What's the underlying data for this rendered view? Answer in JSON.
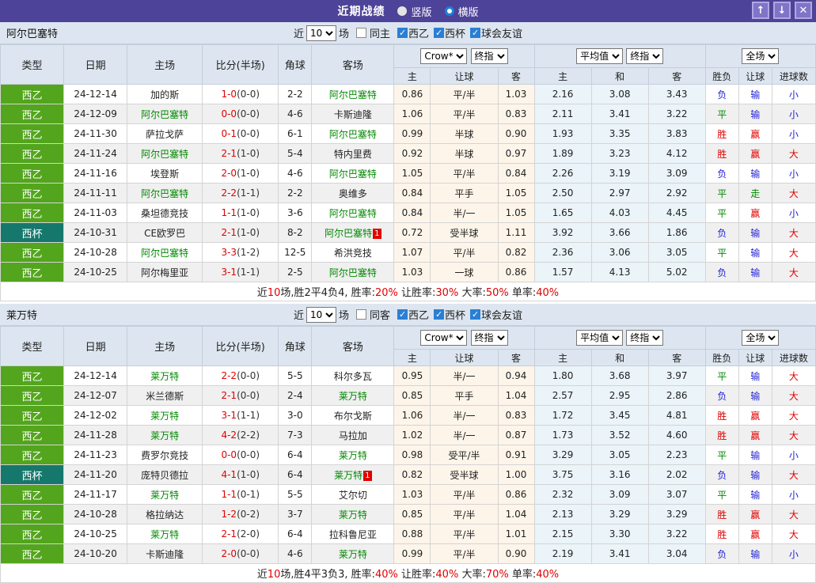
{
  "titlebar": {
    "title": "近期战绩",
    "radios": [
      {
        "label": "竖版",
        "selected": false
      },
      {
        "label": "横版",
        "selected": true
      }
    ],
    "buttons": {
      "up": "↑",
      "down": "↓",
      "close": "✕"
    }
  },
  "colors": {
    "titlebar_purple": "#4d4398",
    "league_green": "#53a51d",
    "cup_teal": "#16786d",
    "team_highlight_green": "#008800",
    "score_red": "#e00000",
    "result_blue": "#2323d3",
    "odds_col_bg": "#fdf5ea",
    "avg_col_bg": "#eaf4f9",
    "header_bg": "#dde6f0"
  },
  "header": {
    "col_type": "类型",
    "col_date": "日期",
    "col_home": "主场",
    "col_score": "比分(半场)",
    "col_corner": "角球",
    "col_away": "客场",
    "dd_crow": "Crow*",
    "dd_final1": "终指",
    "dd_avg": "平均值",
    "dd_final2": "终指",
    "dd_full": "全场",
    "sub": [
      "主",
      "让球",
      "客",
      "主",
      "和",
      "客",
      "胜负",
      "让球",
      "进球数"
    ]
  },
  "sections": [
    {
      "team": "阿尔巴塞特",
      "filter": {
        "prefix": "近",
        "count": "10",
        "suffix": "场",
        "same": {
          "label": "同主",
          "checked": false
        },
        "leagues": [
          {
            "label": "西乙",
            "checked": true
          },
          {
            "label": "西杯",
            "checked": true
          },
          {
            "label": "球会友谊",
            "checked": true
          }
        ]
      },
      "rows": [
        {
          "type": "西乙",
          "cup": false,
          "date": "24-12-14",
          "home": "加的斯",
          "home_hl": false,
          "home_badge": "",
          "score": "1-0",
          "half": "(0-0)",
          "corner": "2-2",
          "away": "阿尔巴塞特",
          "away_hl": true,
          "away_badge": "",
          "o1": "0.86",
          "o2": "平/半",
          "o3": "1.03",
          "a1": "2.16",
          "a2": "3.08",
          "a3": "3.43",
          "r1": "负",
          "r1c": "b",
          "r2": "输",
          "r2c": "b",
          "r3": "小",
          "r3c": "b"
        },
        {
          "type": "西乙",
          "cup": false,
          "date": "24-12-09",
          "home": "阿尔巴塞特",
          "home_hl": true,
          "home_badge": "",
          "score": "0-0",
          "half": "(0-0)",
          "corner": "4-6",
          "away": "卡斯迪隆",
          "away_hl": false,
          "away_badge": "",
          "o1": "1.06",
          "o2": "平/半",
          "o3": "0.83",
          "a1": "2.11",
          "a2": "3.41",
          "a3": "3.22",
          "r1": "平",
          "r1c": "g",
          "r2": "输",
          "r2c": "b",
          "r3": "小",
          "r3c": "b"
        },
        {
          "type": "西乙",
          "cup": false,
          "date": "24-11-30",
          "home": "萨拉戈萨",
          "home_hl": false,
          "home_badge": "",
          "score": "0-1",
          "half": "(0-0)",
          "corner": "6-1",
          "away": "阿尔巴塞特",
          "away_hl": true,
          "away_badge": "",
          "o1": "0.99",
          "o2": "半球",
          "o3": "0.90",
          "a1": "1.93",
          "a2": "3.35",
          "a3": "3.83",
          "r1": "胜",
          "r1c": "r",
          "r2": "赢",
          "r2c": "r",
          "r3": "小",
          "r3c": "b"
        },
        {
          "type": "西乙",
          "cup": false,
          "date": "24-11-24",
          "home": "阿尔巴塞特",
          "home_hl": true,
          "home_badge": "",
          "score": "2-1",
          "half": "(1-0)",
          "corner": "5-4",
          "away": "特内里费",
          "away_hl": false,
          "away_badge": "",
          "o1": "0.92",
          "o2": "半球",
          "o3": "0.97",
          "a1": "1.89",
          "a2": "3.23",
          "a3": "4.12",
          "r1": "胜",
          "r1c": "r",
          "r2": "赢",
          "r2c": "r",
          "r3": "大",
          "r3c": "r"
        },
        {
          "type": "西乙",
          "cup": false,
          "date": "24-11-16",
          "home": "埃登斯",
          "home_hl": false,
          "home_badge": "",
          "score": "2-0",
          "half": "(1-0)",
          "corner": "4-6",
          "away": "阿尔巴塞特",
          "away_hl": true,
          "away_badge": "",
          "o1": "1.05",
          "o2": "平/半",
          "o3": "0.84",
          "a1": "2.26",
          "a2": "3.19",
          "a3": "3.09",
          "r1": "负",
          "r1c": "b",
          "r2": "输",
          "r2c": "b",
          "r3": "小",
          "r3c": "b"
        },
        {
          "type": "西乙",
          "cup": false,
          "date": "24-11-11",
          "home": "阿尔巴塞特",
          "home_hl": true,
          "home_badge": "",
          "score": "2-2",
          "half": "(1-1)",
          "corner": "2-2",
          "away": "奥维多",
          "away_hl": false,
          "away_badge": "",
          "o1": "0.84",
          "o2": "平手",
          "o3": "1.05",
          "a1": "2.50",
          "a2": "2.97",
          "a3": "2.92",
          "r1": "平",
          "r1c": "g",
          "r2": "走",
          "r2c": "g",
          "r3": "大",
          "r3c": "r"
        },
        {
          "type": "西乙",
          "cup": false,
          "date": "24-11-03",
          "home": "桑坦德竞技",
          "home_hl": false,
          "home_badge": "",
          "score": "1-1",
          "half": "(1-0)",
          "corner": "3-6",
          "away": "阿尔巴塞特",
          "away_hl": true,
          "away_badge": "",
          "o1": "0.84",
          "o2": "半/一",
          "o3": "1.05",
          "a1": "1.65",
          "a2": "4.03",
          "a3": "4.45",
          "r1": "平",
          "r1c": "g",
          "r2": "赢",
          "r2c": "r",
          "r3": "小",
          "r3c": "b"
        },
        {
          "type": "西杯",
          "cup": true,
          "date": "24-10-31",
          "home": "CE欧罗巴",
          "home_hl": false,
          "home_badge": "",
          "score": "2-1",
          "half": "(1-0)",
          "corner": "8-2",
          "away": "阿尔巴塞特",
          "away_hl": true,
          "away_badge": "1",
          "o1": "0.72",
          "o2": "受半球",
          "o3": "1.11",
          "a1": "3.92",
          "a2": "3.66",
          "a3": "1.86",
          "r1": "负",
          "r1c": "b",
          "r2": "输",
          "r2c": "b",
          "r3": "大",
          "r3c": "r"
        },
        {
          "type": "西乙",
          "cup": false,
          "date": "24-10-28",
          "home": "阿尔巴塞特",
          "home_hl": true,
          "home_badge": "",
          "score": "3-3",
          "half": "(1-2)",
          "corner": "12-5",
          "away": "希洪竞技",
          "away_hl": false,
          "away_badge": "",
          "o1": "1.07",
          "o2": "平/半",
          "o3": "0.82",
          "a1": "2.36",
          "a2": "3.06",
          "a3": "3.05",
          "r1": "平",
          "r1c": "g",
          "r2": "输",
          "r2c": "b",
          "r3": "大",
          "r3c": "r"
        },
        {
          "type": "西乙",
          "cup": false,
          "date": "24-10-25",
          "home": "阿尔梅里亚",
          "home_hl": false,
          "home_badge": "",
          "score": "3-1",
          "half": "(1-1)",
          "corner": "2-5",
          "away": "阿尔巴塞特",
          "away_hl": true,
          "away_badge": "",
          "o1": "1.03",
          "o2": "一球",
          "o3": "0.86",
          "a1": "1.57",
          "a2": "4.13",
          "a3": "5.02",
          "r1": "负",
          "r1c": "b",
          "r2": "输",
          "r2c": "b",
          "r3": "大",
          "r3c": "r"
        }
      ],
      "summary": [
        {
          "t": "近"
        },
        {
          "t": "10",
          "red": true
        },
        {
          "t": "场,胜2平4负4, 胜率:"
        },
        {
          "t": "20%",
          "red": true
        },
        {
          "t": " 让胜率:"
        },
        {
          "t": "30%",
          "red": true
        },
        {
          "t": " 大率:"
        },
        {
          "t": "50%",
          "red": true
        },
        {
          "t": " 单率:"
        },
        {
          "t": "40%",
          "red": true
        }
      ]
    },
    {
      "team": "莱万特",
      "filter": {
        "prefix": "近",
        "count": "10",
        "suffix": "场",
        "same": {
          "label": "同客",
          "checked": false
        },
        "leagues": [
          {
            "label": "西乙",
            "checked": true
          },
          {
            "label": "西杯",
            "checked": true
          },
          {
            "label": "球会友谊",
            "checked": true
          }
        ]
      },
      "rows": [
        {
          "type": "西乙",
          "cup": false,
          "date": "24-12-14",
          "home": "莱万特",
          "home_hl": true,
          "home_badge": "",
          "score": "2-2",
          "half": "(0-0)",
          "corner": "5-5",
          "away": "科尔多瓦",
          "away_hl": false,
          "away_badge": "",
          "o1": "0.95",
          "o2": "半/一",
          "o3": "0.94",
          "a1": "1.80",
          "a2": "3.68",
          "a3": "3.97",
          "r1": "平",
          "r1c": "g",
          "r2": "输",
          "r2c": "b",
          "r3": "大",
          "r3c": "r"
        },
        {
          "type": "西乙",
          "cup": false,
          "date": "24-12-07",
          "home": "米兰德斯",
          "home_hl": false,
          "home_badge": "",
          "score": "2-1",
          "half": "(0-0)",
          "corner": "2-4",
          "away": "莱万特",
          "away_hl": true,
          "away_badge": "",
          "o1": "0.85",
          "o2": "平手",
          "o3": "1.04",
          "a1": "2.57",
          "a2": "2.95",
          "a3": "2.86",
          "r1": "负",
          "r1c": "b",
          "r2": "输",
          "r2c": "b",
          "r3": "大",
          "r3c": "r"
        },
        {
          "type": "西乙",
          "cup": false,
          "date": "24-12-02",
          "home": "莱万特",
          "home_hl": true,
          "home_badge": "",
          "score": "3-1",
          "half": "(1-1)",
          "corner": "3-0",
          "away": "布尔戈斯",
          "away_hl": false,
          "away_badge": "",
          "o1": "1.06",
          "o2": "半/一",
          "o3": "0.83",
          "a1": "1.72",
          "a2": "3.45",
          "a3": "4.81",
          "r1": "胜",
          "r1c": "r",
          "r2": "赢",
          "r2c": "r",
          "r3": "大",
          "r3c": "r"
        },
        {
          "type": "西乙",
          "cup": false,
          "date": "24-11-28",
          "home": "莱万特",
          "home_hl": true,
          "home_badge": "",
          "score": "4-2",
          "half": "(2-2)",
          "corner": "7-3",
          "away": "马拉加",
          "away_hl": false,
          "away_badge": "",
          "o1": "1.02",
          "o2": "半/一",
          "o3": "0.87",
          "a1": "1.73",
          "a2": "3.52",
          "a3": "4.60",
          "r1": "胜",
          "r1c": "r",
          "r2": "赢",
          "r2c": "r",
          "r3": "大",
          "r3c": "r"
        },
        {
          "type": "西乙",
          "cup": false,
          "date": "24-11-23",
          "home": "费罗尔竞技",
          "home_hl": false,
          "home_badge": "",
          "score": "0-0",
          "half": "(0-0)",
          "corner": "6-4",
          "away": "莱万特",
          "away_hl": true,
          "away_badge": "",
          "o1": "0.98",
          "o2": "受平/半",
          "o3": "0.91",
          "a1": "3.29",
          "a2": "3.05",
          "a3": "2.23",
          "r1": "平",
          "r1c": "g",
          "r2": "输",
          "r2c": "b",
          "r3": "小",
          "r3c": "b"
        },
        {
          "type": "西杯",
          "cup": true,
          "date": "24-11-20",
          "home": "庞特贝德拉",
          "home_hl": false,
          "home_badge": "",
          "score": "4-1",
          "half": "(1-0)",
          "corner": "6-4",
          "away": "莱万特",
          "away_hl": true,
          "away_badge": "1",
          "o1": "0.82",
          "o2": "受半球",
          "o3": "1.00",
          "a1": "3.75",
          "a2": "3.16",
          "a3": "2.02",
          "r1": "负",
          "r1c": "b",
          "r2": "输",
          "r2c": "b",
          "r3": "大",
          "r3c": "r"
        },
        {
          "type": "西乙",
          "cup": false,
          "date": "24-11-17",
          "home": "莱万特",
          "home_hl": true,
          "home_badge": "",
          "score": "1-1",
          "half": "(0-1)",
          "corner": "5-5",
          "away": "艾尔切",
          "away_hl": false,
          "away_badge": "",
          "o1": "1.03",
          "o2": "平/半",
          "o3": "0.86",
          "a1": "2.32",
          "a2": "3.09",
          "a3": "3.07",
          "r1": "平",
          "r1c": "g",
          "r2": "输",
          "r2c": "b",
          "r3": "小",
          "r3c": "b"
        },
        {
          "type": "西乙",
          "cup": false,
          "date": "24-10-28",
          "home": "格拉纳达",
          "home_hl": false,
          "home_badge": "",
          "score": "1-2",
          "half": "(0-2)",
          "corner": "3-7",
          "away": "莱万特",
          "away_hl": true,
          "away_badge": "",
          "o1": "0.85",
          "o2": "平/半",
          "o3": "1.04",
          "a1": "2.13",
          "a2": "3.29",
          "a3": "3.29",
          "r1": "胜",
          "r1c": "r",
          "r2": "赢",
          "r2c": "r",
          "r3": "大",
          "r3c": "r"
        },
        {
          "type": "西乙",
          "cup": false,
          "date": "24-10-25",
          "home": "莱万特",
          "home_hl": true,
          "home_badge": "",
          "score": "2-1",
          "half": "(2-0)",
          "corner": "6-4",
          "away": "拉科鲁尼亚",
          "away_hl": false,
          "away_badge": "",
          "o1": "0.88",
          "o2": "平/半",
          "o3": "1.01",
          "a1": "2.15",
          "a2": "3.30",
          "a3": "3.22",
          "r1": "胜",
          "r1c": "r",
          "r2": "赢",
          "r2c": "r",
          "r3": "大",
          "r3c": "r"
        },
        {
          "type": "西乙",
          "cup": false,
          "date": "24-10-20",
          "home": "卡斯迪隆",
          "home_hl": false,
          "home_badge": "",
          "score": "2-0",
          "half": "(0-0)",
          "corner": "4-6",
          "away": "莱万特",
          "away_hl": true,
          "away_badge": "",
          "o1": "0.99",
          "o2": "平/半",
          "o3": "0.90",
          "a1": "2.19",
          "a2": "3.41",
          "a3": "3.04",
          "r1": "负",
          "r1c": "b",
          "r2": "输",
          "r2c": "b",
          "r3": "小",
          "r3c": "b"
        }
      ],
      "summary": [
        {
          "t": "近"
        },
        {
          "t": "10",
          "red": true
        },
        {
          "t": "场,胜4平3负3, 胜率:"
        },
        {
          "t": "40%",
          "red": true
        },
        {
          "t": " 让胜率:"
        },
        {
          "t": "40%",
          "red": true
        },
        {
          "t": " 大率:"
        },
        {
          "t": "70%",
          "red": true
        },
        {
          "t": " 单率:"
        },
        {
          "t": "40%",
          "red": true
        }
      ]
    }
  ]
}
